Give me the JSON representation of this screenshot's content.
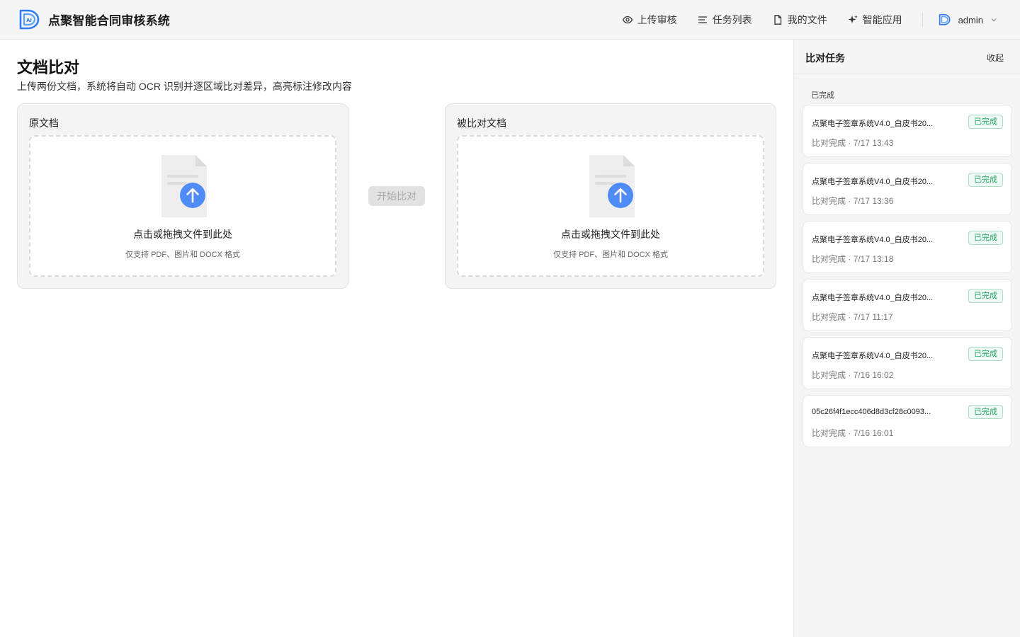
{
  "app": {
    "name": "点聚智能合同审核系统"
  },
  "nav": {
    "items": [
      {
        "label": "上传审核",
        "icon": "eye-icon"
      },
      {
        "label": "任务列表",
        "icon": "list-icon"
      },
      {
        "label": "我的文件",
        "icon": "file-icon"
      },
      {
        "label": "智能应用",
        "icon": "sparkle-icon"
      }
    ],
    "user": {
      "name": "admin",
      "icon": "user-logo-icon"
    }
  },
  "colors": {
    "brand": "#2f7cf6",
    "success": "#21a366",
    "upload_icon": "#4f8cf7"
  },
  "page": {
    "title": "文档比对",
    "subtitle": "上传两份文档，系统将自动 OCR 识别并逐区域比对差异，高亮标注修改内容"
  },
  "compare": {
    "left": {
      "title": "原文档",
      "drop_text": "点击或拖拽文件到此处",
      "hint": "仅支持 PDF、图片和 DOCX 格式"
    },
    "right": {
      "title": "被比对文档",
      "drop_text": "点击或拖拽文件到此处",
      "hint": "仅支持 PDF、图片和 DOCX 格式"
    },
    "start_label": "开始比对"
  },
  "side": {
    "title": "比对任务",
    "collapse_label": "收起",
    "group_label": "已完成",
    "tasks": [
      {
        "name": "点聚电子签章系统V4.0_白皮书20...",
        "status": "已完成",
        "meta": "比对完成 · 7/17 13:43"
      },
      {
        "name": "点聚电子签章系统V4.0_白皮书20...",
        "status": "已完成",
        "meta": "比对完成 · 7/17 13:36"
      },
      {
        "name": "点聚电子签章系统V4.0_白皮书20...",
        "status": "已完成",
        "meta": "比对完成 · 7/17 13:18"
      },
      {
        "name": "点聚电子签章系统V4.0_白皮书20...",
        "status": "已完成",
        "meta": "比对完成 · 7/17 11:17"
      },
      {
        "name": "点聚电子签章系统V4.0_白皮书20...",
        "status": "已完成",
        "meta": "比对完成 · 7/16 16:02"
      },
      {
        "name": "05c26f4f1ecc406d8d3cf28c0093...",
        "status": "已完成",
        "meta": "比对完成 · 7/16 16:01"
      }
    ]
  }
}
